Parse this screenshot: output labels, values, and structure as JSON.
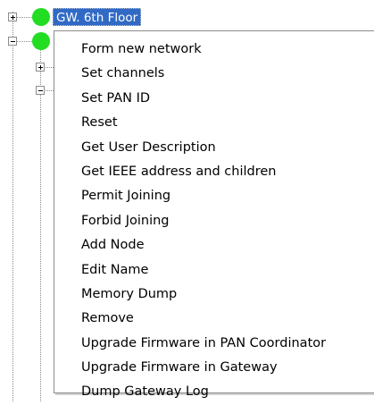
{
  "tree": {
    "nodes": [
      {
        "label": "GW. 6th Floor",
        "state": "collapsed",
        "status_color": "#22dd22",
        "selected": true
      },
      {
        "label": "",
        "state": "expanded",
        "status_color": "#22dd22",
        "selected": false
      },
      {
        "label": "",
        "state": "collapsed",
        "status_color": "",
        "selected": false
      },
      {
        "label": "",
        "state": "expanded",
        "status_color": "",
        "selected": false
      }
    ]
  },
  "context_menu": {
    "items": [
      {
        "label": "Form new network"
      },
      {
        "label": "Set channels"
      },
      {
        "label": "Set PAN ID"
      },
      {
        "label": "Reset"
      },
      {
        "label": "Get User Description"
      },
      {
        "label": "Get IEEE address and children"
      },
      {
        "label": "Permit Joining"
      },
      {
        "label": "Forbid Joining"
      },
      {
        "label": "Add Node"
      },
      {
        "label": "Edit Name"
      },
      {
        "label": "Memory Dump"
      },
      {
        "label": "Remove"
      },
      {
        "label": "Upgrade Firmware in PAN Coordinator"
      },
      {
        "label": "Upgrade Firmware in Gateway"
      },
      {
        "label": "Dump Gateway Log"
      }
    ]
  },
  "colors": {
    "selection": "#316ac5",
    "status_online": "#22dd22",
    "tree_lines": "#8a8a8a"
  }
}
